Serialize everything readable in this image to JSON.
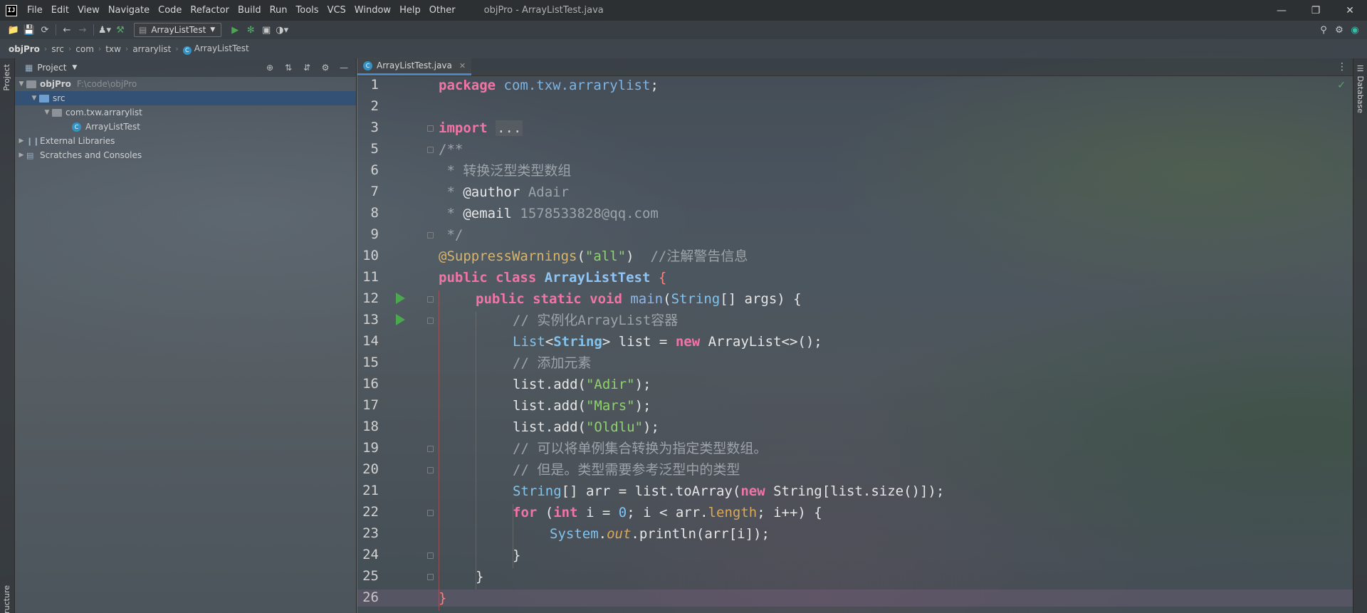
{
  "app": {
    "logo_text": "IJ",
    "menu": [
      "File",
      "Edit",
      "View",
      "Navigate",
      "Code",
      "Refactor",
      "Build",
      "Run",
      "Tools",
      "VCS",
      "Window",
      "Help",
      "Other"
    ],
    "window_title": "objPro - ArrayListTest.java"
  },
  "toolbar": {
    "run_config": "ArrayListTest"
  },
  "breadcrumbs": [
    "objPro",
    "src",
    "com",
    "txw",
    "arrarylist",
    "ArrayListTest"
  ],
  "left_stripe": {
    "project_label": "Project",
    "structure_label": "ructure"
  },
  "right_stripe": {
    "database_label": "Database"
  },
  "project_panel": {
    "title": "Project",
    "tree": [
      {
        "label": "objPro",
        "hint": "F:\\code\\objPro"
      },
      {
        "label": "src"
      },
      {
        "label": "com.txw.arrarylist"
      },
      {
        "label": "ArrayListTest"
      },
      {
        "label": "External Libraries"
      },
      {
        "label": "Scratches and Consoles"
      }
    ]
  },
  "editor": {
    "tab_label": "ArrayListTest.java",
    "line_numbers": [
      "1",
      "2",
      "3",
      "5",
      "6",
      "7",
      "8",
      "9",
      "10",
      "11",
      "12",
      "13",
      "14",
      "15",
      "16",
      "17",
      "18",
      "19",
      "20",
      "21",
      "22",
      "23",
      "24",
      "25",
      "26"
    ],
    "code": {
      "l1_kw": "package",
      "l1_pkg": "com.txw.arrarylist",
      "l1_end": ";",
      "l3_kw": "import",
      "l3_dots": "...",
      "l5": "/**",
      "l6": " * 转换泛型类型数组",
      "l7_star": " * ",
      "l7_tag": "@author",
      "l7_val": " Adair",
      "l8_star": " * ",
      "l8_tag": "@email",
      "l8_val": " 1578533828@qq.com",
      "l9": " */",
      "l10_ann": "@SuppressWarnings",
      "l10_open": "(",
      "l10_str": "\"all\"",
      "l10_close": ")",
      "l10_cm": "  //注解警告信息",
      "l11_kw": "public class ",
      "l11_cls": "ArrayListTest",
      "l11_brace": " {",
      "l12_kw": "public static void ",
      "l12_fn": "main",
      "l12_open": "(",
      "l12_typ": "String",
      "l12_rest": "[] args) {",
      "l13": "// 实例化ArrayList容器",
      "l14_typ1": "List",
      "l14_lt": "<",
      "l14_typ2": "String",
      "l14_mid": "> list = ",
      "l14_kw": "new",
      "l14_rest": " ArrayList<>();",
      "l15": "// 添加元素",
      "l16_a": "list.add(",
      "l16_s": "\"Adir\"",
      "l16_b": ");",
      "l17_a": "list.add(",
      "l17_s": "\"Mars\"",
      "l17_b": ");",
      "l18_a": "list.add(",
      "l18_s": "\"Oldlu\"",
      "l18_b": ");",
      "l19": "// 可以将单例集合转换为指定类型数组。",
      "l20": "// 但是。类型需要参考泛型中的类型",
      "l21_typ": "String",
      "l21_a": "[] arr = list.toArray(",
      "l21_kw": "new",
      "l21_b": " String[list.size()]);",
      "l22_kw1": "for",
      "l22_a": " (",
      "l22_kw2": "int",
      "l22_b": " i = ",
      "l22_num": "0",
      "l22_c": "; i < arr.",
      "l22_fld": "length",
      "l22_d": "; i++) {",
      "l23_typ": "System",
      "l23_dot": ".",
      "l23_out": "out",
      "l23_rest": ".println(arr[i]);",
      "l24": "}",
      "l25": "}",
      "l26": "}"
    }
  },
  "colors": {
    "keyword": "#f075a6",
    "string": "#8fd16e",
    "comment": "#9ca3a9",
    "annotation": "#d7b56d",
    "selection": "#2d5078",
    "run_icon": "#4ba84f"
  }
}
